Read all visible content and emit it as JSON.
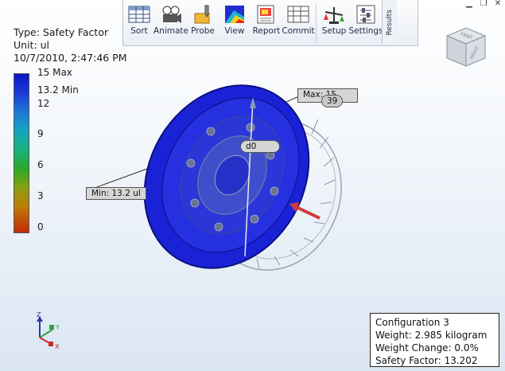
{
  "ribbon": {
    "buttons": [
      {
        "label": "Sort",
        "icon": "sort-table-icon"
      },
      {
        "label": "Animate",
        "icon": "animate-film-icon"
      },
      {
        "label": "Probe",
        "icon": "probe-icon"
      },
      {
        "label": "View",
        "icon": "view-mesh-icon"
      },
      {
        "label": "Report",
        "icon": "report-icon"
      },
      {
        "label": "Commit",
        "icon": "commit-grid-icon"
      },
      {
        "label": "Setup",
        "icon": "setup-scale-icon"
      },
      {
        "label": "Settings",
        "icon": "settings-sliders-icon"
      }
    ],
    "panel_tab": "Results"
  },
  "legend": {
    "type": "Type: Safety Factor",
    "unit": "Unit: ul",
    "datetime": "10/7/2010, 2:47:46 PM",
    "ticks": [
      "15 Max",
      "13.2 Min",
      "12",
      "9",
      "6",
      "3",
      "0"
    ]
  },
  "callouts": {
    "max": "Max: 15",
    "max_partial": "39",
    "probe": "d0",
    "min": "Min: 13.2 ul"
  },
  "viewcube": {
    "face_top": "FRNT",
    "face_side": "RIGHT"
  },
  "triad": {
    "x": "X",
    "y": "Y",
    "z": "Z"
  },
  "info": {
    "configuration": "Configuration 3",
    "weight": "Weight: 2.985 kilogram",
    "weight_change": "Weight Change: 0.0%",
    "safety_factor": "Safety Factor: 13.202"
  },
  "colors": {
    "model": "#1420d8",
    "accent_arrow": "#d23a3a"
  }
}
